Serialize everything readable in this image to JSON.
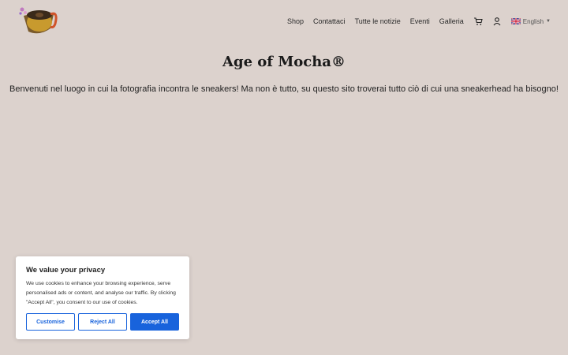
{
  "header": {
    "nav": [
      {
        "label": "Shop"
      },
      {
        "label": "Contattaci"
      },
      {
        "label": "Tutte le notizie"
      },
      {
        "label": "Eventi"
      },
      {
        "label": "Galleria"
      }
    ],
    "cart_icon": "cart-icon",
    "account_icon": "user-icon",
    "language": "English"
  },
  "main": {
    "title": "Age of Mocha®",
    "intro": "Benvenuti nel luogo in cui la fotografia incontra le sneakers! Ma non è tutto, su questo sito troverai tutto ciò di cui una sneakerhead ha bisogno!"
  },
  "cookie": {
    "title": "We value your privacy",
    "text": "We use cookies to enhance your browsing experience, serve personalised ads or content, and analyse our traffic. By clicking \"Accept All\", you consent to our use of cookies.",
    "customise": "Customise",
    "reject": "Reject All",
    "accept": "Accept All",
    "accent": "#1863dc"
  }
}
